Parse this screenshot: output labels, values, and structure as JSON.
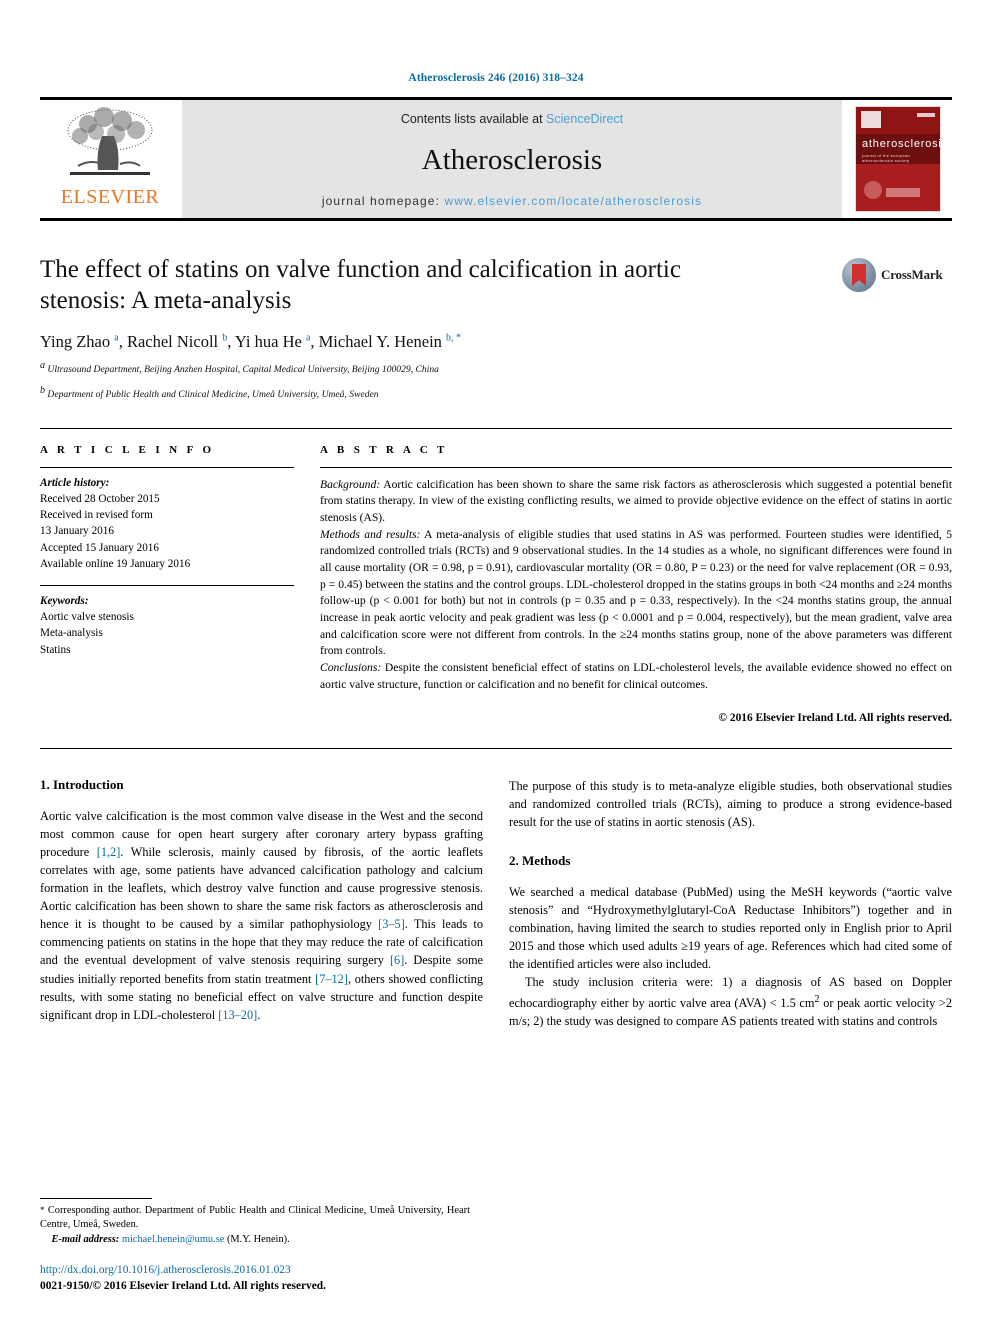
{
  "running_head": "Atherosclerosis 246 (2016) 318–324",
  "masthead": {
    "publisher_name": "ELSEVIER",
    "publisher_logo": "elsevier-tree-logo",
    "contents_prefix": "Contents lists available at ",
    "contents_link": "ScienceDirect",
    "journal_name": "Atherosclerosis",
    "homepage_prefix": "journal homepage: ",
    "homepage_url": "www.elsevier.com/locate/atherosclerosis",
    "cover": {
      "title": "atherosclerosis",
      "subtitle": "journal of the european atherosclerosis society"
    }
  },
  "article": {
    "title": "The effect of statins on valve function and calcification in aortic stenosis: A meta-analysis",
    "crossmark_label": "CrossMark",
    "authors_html": "Ying Zhao <sup>a</sup>, Rachel Nicoll <sup>b</sup>, Yi hua He <sup>a</sup>, Michael Y. Henein <sup>b, *</sup>",
    "affiliation_a": "Ultrasound Department, Beijing Anzhen Hospital, Capital Medical University, Beijing 100029, China",
    "affiliation_b": "Department of Public Health and Clinical Medicine, Umeå University, Umeå, Sweden"
  },
  "article_info": {
    "heading": "A R T I C L E   I N F O",
    "history_label": "Article history:",
    "history": [
      "Received 28 October 2015",
      "Received in revised form",
      "13 January 2016",
      "Accepted 15 January 2016",
      "Available online 19 January 2016"
    ],
    "keywords_label": "Keywords:",
    "keywords": [
      "Aortic valve stenosis",
      "Meta-analysis",
      "Statins"
    ]
  },
  "abstract": {
    "heading": "A B S T R A C T",
    "background_label": "Background:",
    "background_text": " Aortic calcification has been shown to share the same risk factors as atherosclerosis which suggested a potential benefit from statins therapy. In view of the existing conflicting results, we aimed to provide objective evidence on the effect of statins in aortic stenosis (AS).",
    "methods_label": "Methods and results:",
    "methods_text": " A meta-analysis of eligible studies that used statins in AS was performed. Fourteen studies were identified, 5 randomized controlled trials (RCTs) and 9 observational studies. In the 14 studies as a whole, no significant differences were found in all cause mortality (OR = 0.98, p = 0.91), cardiovascular mortality (OR = 0.80, P = 0.23) or the need for valve replacement (OR = 0.93, p = 0.45) between the statins and the control groups. LDL-cholesterol dropped in the statins groups in both <24 months and ≥24 months follow-up (p < 0.001 for both) but not in controls (p = 0.35 and p = 0.33, respectively). In the <24 months statins group, the annual increase in peak aortic velocity and peak gradient was less (p < 0.0001 and p = 0.004, respectively), but the mean gradient, valve area and calcification score were not different from controls. In the ≥24 months statins group, none of the above parameters was different from controls.",
    "conclusions_label": "Conclusions:",
    "conclusions_text": " Despite the consistent beneficial effect of statins on LDL-cholesterol levels, the available evidence showed no effect on aortic valve structure, function or calcification and no benefit for clinical outcomes.",
    "copyright": "© 2016 Elsevier Ireland Ltd. All rights reserved."
  },
  "sections": {
    "introduction_heading": "1. Introduction",
    "intro_p1_a": "Aortic valve calcification is the most common valve disease in the West and the second most common cause for open heart surgery after coronary artery bypass grafting procedure ",
    "intro_p1_ref1": "[1,2]",
    "intro_p1_b": ". While sclerosis, mainly caused by fibrosis, of the aortic leaflets correlates with age, some patients have advanced calcification pathology and calcium formation in the leaflets, which destroy valve function and cause progressive stenosis. Aortic calcification has been shown to share the same risk factors as atherosclerosis and hence it is thought to be caused by a similar pathophysiology ",
    "intro_p1_ref2": "[3–5]",
    "intro_p1_c": ". This leads to commencing patients on statins in the hope that they may reduce the rate of calcification and the eventual development of valve stenosis requiring surgery ",
    "intro_p1_ref3": "[6]",
    "intro_p1_d": ". Despite some studies initially reported benefits from statin treatment ",
    "intro_p1_ref4": "[7–12]",
    "intro_p1_e": ", others showed conflicting results, with some stating no beneficial effect on valve structure and function despite significant drop in LDL-cholesterol ",
    "intro_p1_ref5": "[13–20]",
    "intro_p1_f": ".",
    "intro_p2": "The purpose of this study is to meta-analyze eligible studies, both observational studies and randomized controlled trials (RCTs), aiming to produce a strong evidence-based result for the use of statins in aortic stenosis (AS).",
    "methods_heading": "2. Methods",
    "methods_p1": "We searched a medical database (PubMed) using the MeSH keywords (“aortic valve stenosis” and “Hydroxymethylglutaryl-CoA Reductase Inhibitors”) together and in combination, having limited the search to studies reported only in English prior to April 2015 and those which used adults ≥19 years of age. References which had cited some of the identified articles were also included.",
    "methods_p2_a": "The study inclusion criteria were: 1) a diagnosis of AS based on Doppler echocardiography either by aortic valve area (AVA) < 1.5 cm",
    "methods_p2_sup": "2",
    "methods_p2_b": " or peak aortic velocity >2 m/s; 2) the study was designed to compare AS patients treated with statins and controls"
  },
  "footnotes": {
    "corresponding_star": "*",
    "corresponding_text": " Corresponding author. Department of Public Health and Clinical Medicine, Umeå University, Heart Centre, Umeå, Sweden.",
    "email_label": "E-mail address:",
    "email_address": "michael.henein@umu.se",
    "email_owner": " (M.Y. Henein).",
    "doi_url": "http://dx.doi.org/10.1016/j.atherosclerosis.2016.01.023",
    "issn_line": "0021-9150/© 2016 Elsevier Ireland Ltd. All rights reserved."
  },
  "colors": {
    "link_blue": "#0b6ca0",
    "sciencedirect_blue": "#4a9fd5",
    "elsevier_orange": "#E87722",
    "cover_red": "#A81E1E"
  }
}
